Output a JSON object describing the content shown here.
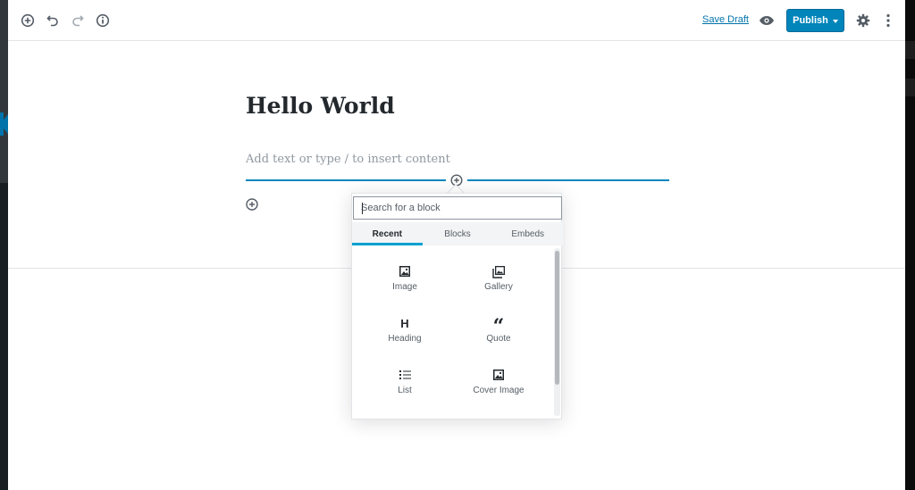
{
  "header": {
    "save_draft_label": "Save Draft",
    "publish_label": "Publish"
  },
  "post": {
    "title": "Hello World",
    "body_placeholder": "Add text or type / to insert content"
  },
  "inserter": {
    "search_placeholder": "Search for a block",
    "tabs": [
      {
        "label": "Recent",
        "active": true
      },
      {
        "label": "Blocks",
        "active": false
      },
      {
        "label": "Embeds",
        "active": false
      }
    ],
    "blocks": [
      {
        "label": "Image",
        "icon": "image-icon"
      },
      {
        "label": "Gallery",
        "icon": "gallery-icon"
      },
      {
        "label": "Heading",
        "icon": "heading-icon",
        "glyph": "H"
      },
      {
        "label": "Quote",
        "icon": "quote-icon",
        "glyph": "“"
      },
      {
        "label": "List",
        "icon": "list-icon"
      },
      {
        "label": "Cover Image",
        "icon": "cover-image-icon"
      }
    ]
  },
  "colors": {
    "accent": "#0085ba",
    "link": "#0073aa",
    "insertion_line": "#0087be",
    "admin_bar": "#23282d"
  }
}
